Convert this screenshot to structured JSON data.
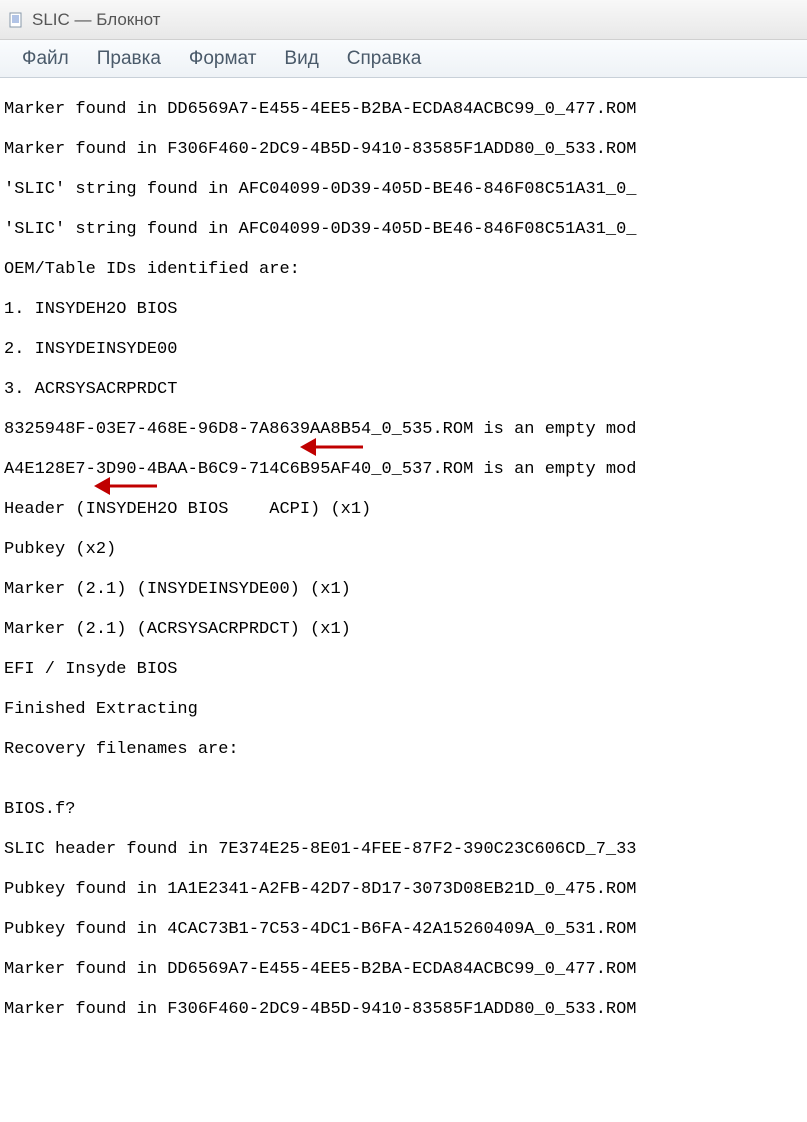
{
  "window": {
    "title": "SLIC — Блокнот"
  },
  "menu": {
    "items": [
      "Файл",
      "Правка",
      "Формат",
      "Вид",
      "Справка"
    ]
  },
  "content": {
    "lines": [
      "Marker found in DD6569A7-E455-4EE5-B2BA-ECDA84ACBC99_0_477.ROM",
      "Marker found in F306F460-2DC9-4B5D-9410-83585F1ADD80_0_533.ROM",
      "'SLIC' string found in AFC04099-0D39-405D-BE46-846F08C51A31_0_",
      "'SLIC' string found in AFC04099-0D39-405D-BE46-846F08C51A31_0_",
      "OEM/Table IDs identified are:",
      "1. INSYDEH2O BIOS",
      "2. INSYDEINSYDE00",
      "3. ACRSYSACRPRDCT",
      "8325948F-03E7-468E-96D8-7A8639AA8B54_0_535.ROM is an empty mod",
      "A4E128E7-3D90-4BAA-B6C9-714C6B95AF40_0_537.ROM is an empty mod",
      "Header (INSYDEH2O BIOS    ACPI) (x1)",
      "Pubkey (x2)",
      "Marker (2.1) (INSYDEINSYDE00) (x1)",
      "Marker (2.1) (ACRSYSACRPRDCT) (x1)",
      "EFI / Insyde BIOS",
      "Finished Extracting",
      "Recovery filenames are:",
      "",
      "BIOS.f?",
      "SLIC header found in 7E374E25-8E01-4FEE-87F2-390C23C606CD_7_33",
      "Pubkey found in 1A1E2341-A2FB-42D7-8D17-3073D08EB21D_0_475.ROM",
      "Pubkey found in 4CAC73B1-7C53-4DC1-B6FA-42A15260409A_0_531.ROM",
      "Marker found in DD6569A7-E455-4EE5-B2BA-ECDA84ACBC99_0_477.ROM",
      "Marker found in F306F460-2DC9-4B5D-9410-83585F1ADD80_0_533.ROM"
    ]
  },
  "annotations": {
    "arrow1_color": "#c00000",
    "arrow2_color": "#c00000"
  }
}
